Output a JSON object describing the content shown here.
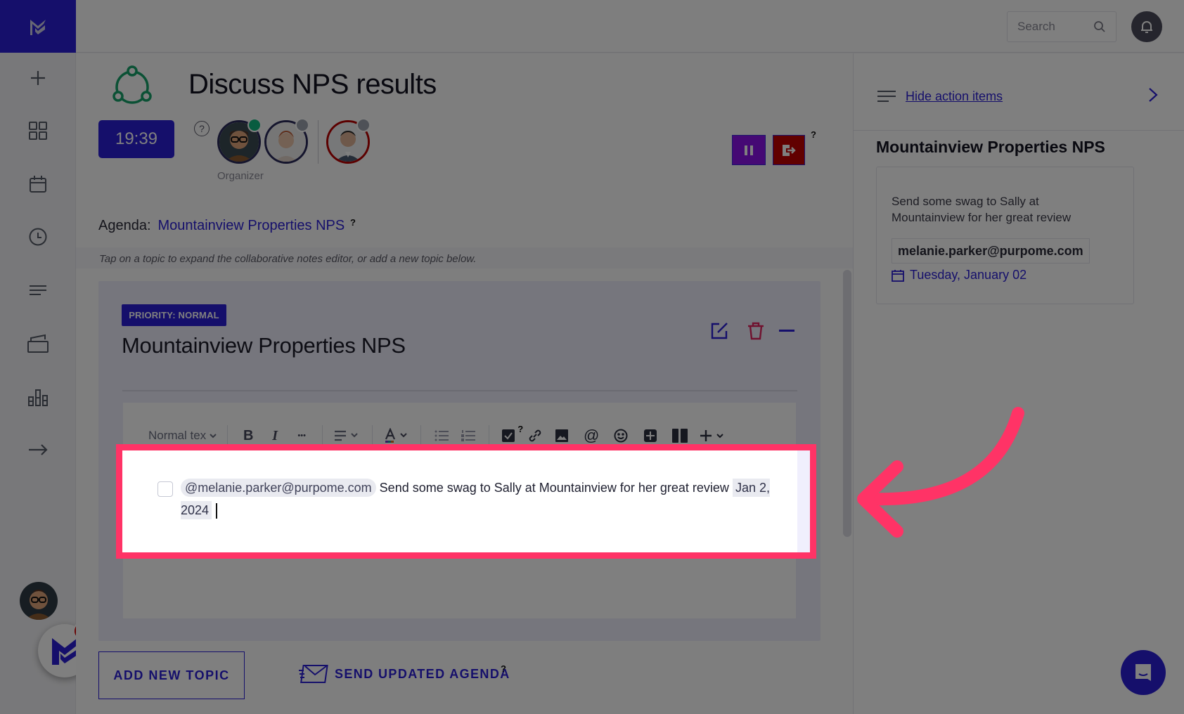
{
  "header": {
    "search_placeholder": "Search",
    "search_icon": "search-icon",
    "notification_icon": "bell-icon"
  },
  "sidebar": {
    "logo": "app-logo",
    "items": [
      {
        "name": "new",
        "icon": "plus-icon"
      },
      {
        "name": "dashboard",
        "icon": "grid-icon"
      },
      {
        "name": "calendar",
        "icon": "calendar-icon"
      },
      {
        "name": "history",
        "icon": "clock-icon"
      },
      {
        "name": "agendas",
        "icon": "lines-icon"
      },
      {
        "name": "templates",
        "icon": "clapperboard-icon"
      },
      {
        "name": "analytics",
        "icon": "bar-chart-icon"
      },
      {
        "name": "logout",
        "icon": "arrow-right-icon"
      }
    ],
    "notification_count": "1"
  },
  "meeting": {
    "title": "Discuss NPS results",
    "timer": "19:39",
    "help": "?",
    "organizer_label": "Organizer",
    "attendees": [
      {
        "role": "organizer",
        "status": "online",
        "status_color": "#10b981"
      },
      {
        "role": "attendee",
        "status": "offline",
        "status_color": "#9ca3af"
      },
      {
        "role": "guest",
        "status": "offline",
        "status_color": "#9ca3af"
      }
    ],
    "pause_label": "Pause meeting",
    "leave_label": "Leave meeting",
    "controls_help": "?"
  },
  "agenda": {
    "label": "Agenda:",
    "name": "Mountainview Properties NPS",
    "help": "?",
    "hint": "Tap on a topic to expand the collaborative notes editor, or add a new topic below."
  },
  "topic": {
    "priority": "PRIORITY: NORMAL",
    "title": "Mountainview Properties NPS",
    "toolbar": {
      "text_style": "Normal tex",
      "bold": "B",
      "italic": "I",
      "more": "•••",
      "help": "?"
    },
    "action_item": {
      "checked": false,
      "mention": "@melanie.parker@purpome.com",
      "text": "Send some swag to Sally at Mountainview for her great review",
      "date": "Jan 2, 2024"
    }
  },
  "footer": {
    "add_topic": "ADD NEW TOPIC",
    "send_agenda": "SEND UPDATED AGENDA",
    "send_help": "?"
  },
  "right_panel": {
    "hide_label": "Hide action items",
    "section_title": "Mountainview Properties NPS",
    "item": {
      "description": "Send some swag to Sally at Mountainview for her great review",
      "assignee": "melanie.parker@purpome.com",
      "due": "Tuesday, January 02"
    }
  },
  "colors": {
    "brand": "#2a1fd6",
    "highlight": "#ff3366",
    "pause": "#8a12e8",
    "leave": "#c20000"
  }
}
